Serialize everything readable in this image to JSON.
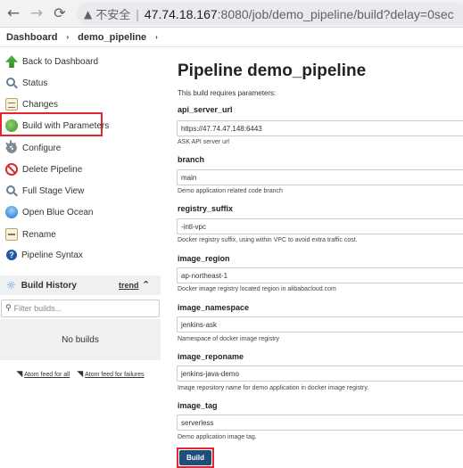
{
  "browser": {
    "back_icon": "←",
    "forward_icon": "→",
    "reload_icon": "C",
    "insecure_label": "不安全",
    "url_host": "47.74.18.167",
    "url_rest": ":8080/job/demo_pipeline/build?delay=0sec"
  },
  "breadcrumb": {
    "dashboard": "Dashboard",
    "job": "demo_pipeline",
    "arrow": "›"
  },
  "sidebar": {
    "items": [
      {
        "label": "Back to Dashboard",
        "icon": "back-arrow-icon"
      },
      {
        "label": "Status",
        "icon": "magnifier-icon"
      },
      {
        "label": "Changes",
        "icon": "notepad-icon"
      },
      {
        "label": "Build with Parameters",
        "icon": "build-clock-icon"
      },
      {
        "label": "Configure",
        "icon": "gear-icon"
      },
      {
        "label": "Delete Pipeline",
        "icon": "no-entry-icon"
      },
      {
        "label": "Full Stage View",
        "icon": "magnifier-icon"
      },
      {
        "label": "Open Blue Ocean",
        "icon": "blue-ocean-icon"
      },
      {
        "label": "Rename",
        "icon": "notepad-icon"
      },
      {
        "label": "Pipeline Syntax",
        "icon": "help-icon"
      }
    ],
    "build_history": {
      "title": "Build History",
      "trend": "trend",
      "filter_placeholder": "Filter builds...",
      "empty": "No builds",
      "feed_all": "Atom feed for all",
      "feed_failures": "Atom feed for failures"
    }
  },
  "main": {
    "title": "Pipeline demo_pipeline",
    "requires": "This build requires parameters:",
    "params": [
      {
        "name": "api_server_url",
        "value": "https://47.74.47.148:6443",
        "desc": "ASK API server url"
      },
      {
        "name": "branch",
        "value": "main",
        "desc": "Demo application related code branch"
      },
      {
        "name": "registry_suffix",
        "value": "-intl-vpc",
        "desc": "Docker registry suffix, using within VPC to avoid extra traffic cost."
      },
      {
        "name": "image_region",
        "value": "ap-northeast-1",
        "desc": "Docker image registry located region in alibabacloud.com"
      },
      {
        "name": "image_namespace",
        "value": "jenkins-ask",
        "desc": "Namespace of docker image registry"
      },
      {
        "name": "image_reponame",
        "value": "jenkins-java-demo",
        "desc": "Image repository name for demo application in docker image registry."
      },
      {
        "name": "image_tag",
        "value": "serverless",
        "desc": "Demo application image tag."
      }
    ],
    "build_label": "Build"
  },
  "colors": {
    "highlight": "#e0272d",
    "build_button": "#1f4e7a"
  }
}
